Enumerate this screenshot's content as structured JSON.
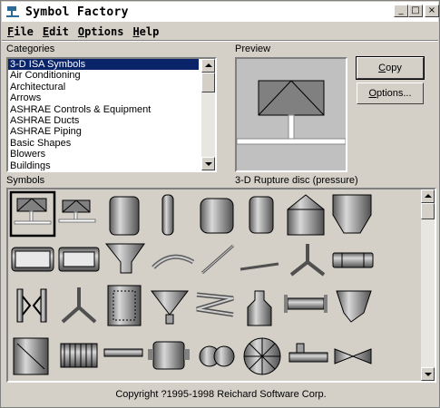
{
  "window": {
    "title": "Symbol Factory",
    "minimize": "_",
    "maximize": "□",
    "close": "×"
  },
  "menu": [
    {
      "label": "File",
      "u": "F",
      "rest": "ile"
    },
    {
      "label": "Edit",
      "u": "E",
      "rest": "dit"
    },
    {
      "label": "Options",
      "u": "O",
      "rest": "ptions"
    },
    {
      "label": "Help",
      "u": "H",
      "rest": "elp"
    }
  ],
  "categories": {
    "label": "Categories",
    "selected_index": 0,
    "items": [
      "3-D ISA Symbols",
      "Air Conditioning",
      "Architectural",
      "Arrows",
      "ASHRAE Controls & Equipment",
      "ASHRAE Ducts",
      "ASHRAE Piping",
      "Basic Shapes",
      "Blowers",
      "Buildings"
    ]
  },
  "preview": {
    "label": "Preview",
    "caption": "3-D Rupture disc (pressure)"
  },
  "buttons": {
    "copy_u": "C",
    "copy_rest": "opy",
    "options_u": "O",
    "options_rest": "ptions..."
  },
  "symbols": {
    "label": "Symbols",
    "selected": "3-D Rupture disc (pressure)"
  },
  "footer": {
    "copyright": "Copyright ?1995-1998 Reichard Software Corp."
  }
}
